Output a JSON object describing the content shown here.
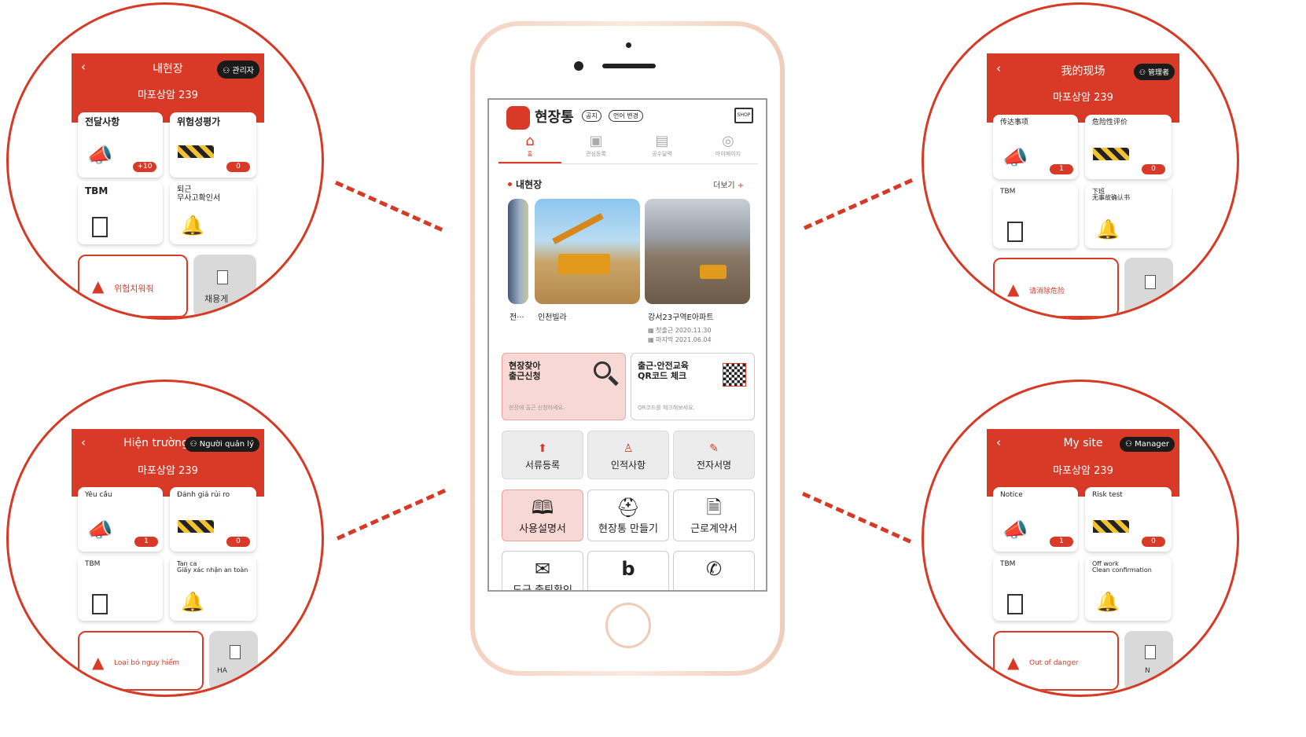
{
  "circles": {
    "ko": {
      "title": "내현장",
      "admin": "관리자",
      "site": "마포상암 239",
      "cards": [
        "전달사항",
        "위험성평가",
        "TBM",
        "퇴근\n무사고확인서"
      ],
      "badges": [
        "+10",
        "0"
      ],
      "danger": "위험치워줘",
      "more": "채용게"
    },
    "zh": {
      "title": "我的现场",
      "admin": "管理者",
      "site": "마포상암 239",
      "cards": [
        "传达事项",
        "危险性评价",
        "TBM",
        "下班\n无事故确认书"
      ],
      "badges": [
        "1",
        "0"
      ],
      "danger": "请消除危险",
      "more": ""
    },
    "vi": {
      "title": "Hiện trường",
      "admin": "Người quản lý",
      "site": "마포상암 239",
      "cards": [
        "Yêu cầu",
        "Đánh giá rủi ro",
        "TBM",
        "Tan ca\nGiấy xác nhận an toàn"
      ],
      "badges": [
        "1",
        "0"
      ],
      "danger": "Loại bỏ nguy hiểm",
      "more": "HA"
    },
    "en": {
      "title": "My site",
      "admin": "Manager",
      "site": "마포상암 239",
      "cards": [
        "Notice",
        "Risk test",
        "TBM",
        "Off work\nClean confirmation"
      ],
      "badges": [
        "1",
        "0"
      ],
      "danger": "Out of danger",
      "more": "N"
    }
  },
  "app": {
    "name": "현장통",
    "chips": [
      "공지",
      "언어 변경"
    ],
    "shop": "SHOP",
    "tabs": [
      "홈",
      "관심등록",
      "공수달력",
      "마이페이지"
    ],
    "section_title": "내현장",
    "more_link": "더보기",
    "sites": [
      {
        "name": "전···"
      },
      {
        "name": "인천빌라"
      },
      {
        "name": "강서23구역E아파트",
        "first_label": "첫출근",
        "first": "2020.11.30",
        "last_label": "마지막",
        "last": "2021.06.04"
      }
    ],
    "find_site": {
      "title": "현장찾아\n출근신청",
      "sub": "현장에 출근 신청하세요."
    },
    "qr_check": {
      "title": "출근·안전교육\nQR코드 체크",
      "sub": "QR코드를 체크해보세요."
    },
    "grid1": [
      "서류등록",
      "인적사항",
      "전자서명"
    ],
    "grid2": [
      "사용설명서",
      "현장통 만들기",
      "근로계약서"
    ],
    "grid3_partial": "도근 출퇴확인"
  }
}
